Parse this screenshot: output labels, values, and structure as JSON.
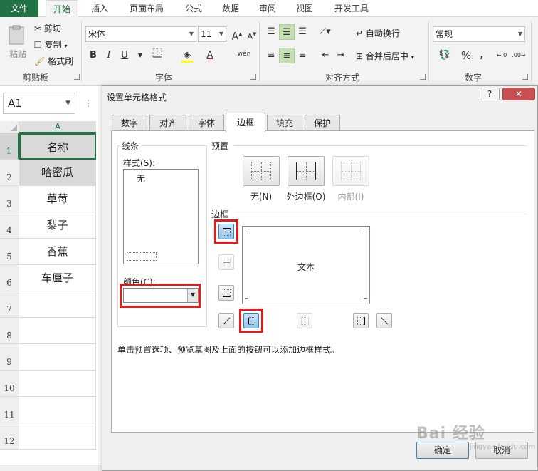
{
  "ribbon": {
    "tabs": [
      "文件",
      "开始",
      "插入",
      "页面布局",
      "公式",
      "数据",
      "审阅",
      "视图",
      "开发工具"
    ],
    "clipboard": {
      "paste": "粘贴",
      "cut": "剪切",
      "copy": "复制",
      "format_painter": "格式刷",
      "label": "剪贴板"
    },
    "font": {
      "name": "宋体",
      "size": "11",
      "label": "字体",
      "bold": "B",
      "italic": "I",
      "underline": "U",
      "grow": "A",
      "shrink": "A",
      "font_color": "A",
      "phonetic": "wén"
    },
    "alignment": {
      "wrap": "自动换行",
      "merge": "合并后居中",
      "label": "对齐方式"
    },
    "number": {
      "format": "常规",
      "percent": "%",
      "comma": ",",
      "label": "数字"
    }
  },
  "sheet": {
    "name_box": "A1",
    "column": "A",
    "rows": [
      "1",
      "2",
      "3",
      "4",
      "5",
      "6",
      "7",
      "8",
      "9",
      "10",
      "11",
      "12"
    ],
    "cells": [
      "名称",
      "哈密瓜",
      "草莓",
      "梨子",
      "香蕉",
      "车厘子"
    ]
  },
  "dialog": {
    "title": "设置单元格格式",
    "help": "?",
    "close": "✕",
    "tabs": [
      "数字",
      "对齐",
      "字体",
      "边框",
      "填充",
      "保护"
    ],
    "active_tab": "边框",
    "line_group": "线条",
    "style_label": "样式(S):",
    "style_none": "无",
    "color_label": "颜色(C):",
    "presets_group": "预置",
    "presets": [
      "无(N)",
      "外边框(O)",
      "内部(I)"
    ],
    "border_group": "边框",
    "preview_text": "文本",
    "hint": "单击预置选项、预览草图及上面的按钮可以添加边框样式。",
    "ok": "确定",
    "cancel": "取消",
    "highlight_color": "#e21b1b"
  },
  "watermark": {
    "text": "Bai 经验",
    "sub": "jingyan.baidu.com"
  }
}
